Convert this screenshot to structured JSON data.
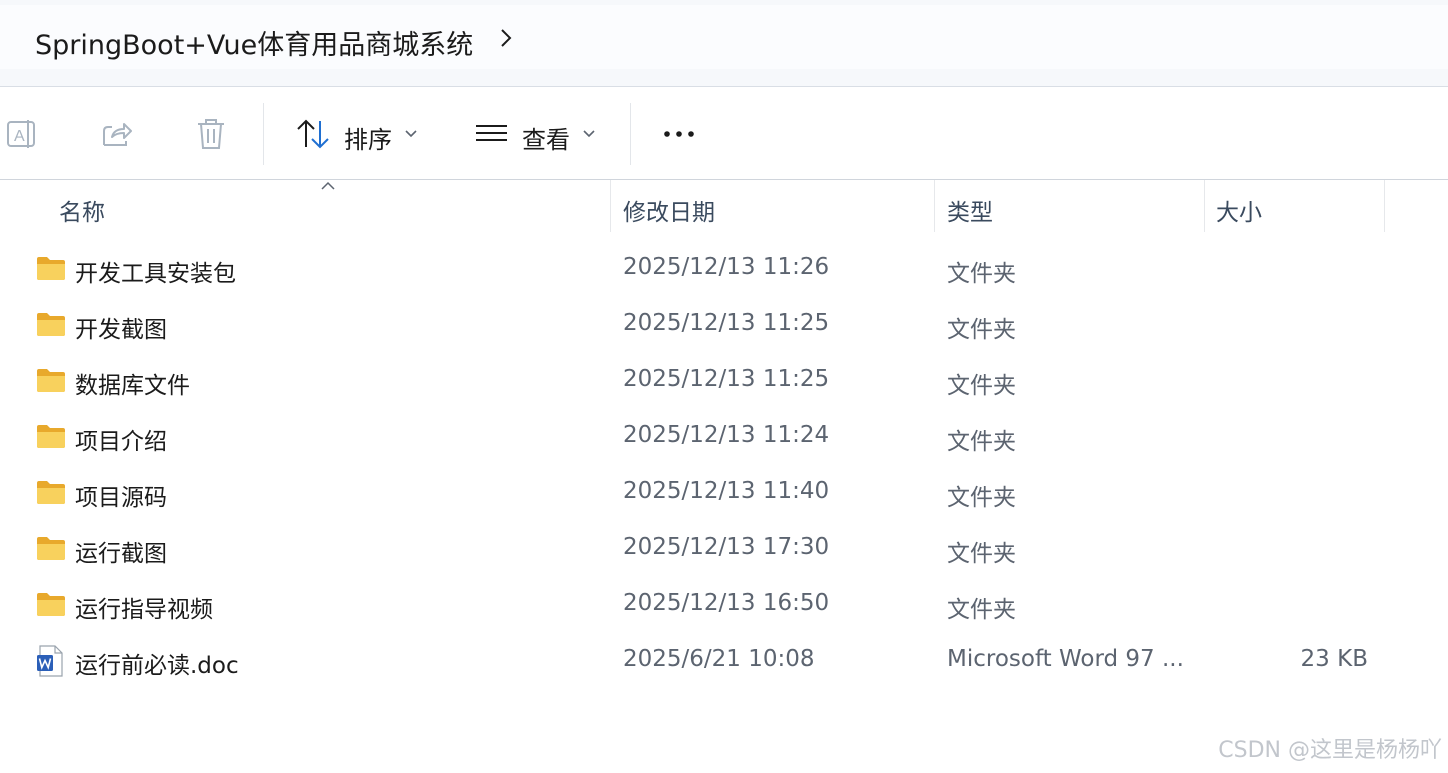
{
  "breadcrumb": {
    "path": "SpringBoot+Vue体育用品商城系统"
  },
  "toolbar": {
    "rename_icon": "rename-icon",
    "share_icon": "share-icon",
    "delete_icon": "trash-icon",
    "sort_label": "排序",
    "view_label": "查看",
    "more_label": "•••"
  },
  "columns": {
    "name": "名称",
    "date": "修改日期",
    "type": "类型",
    "size": "大小"
  },
  "files": [
    {
      "name": "开发工具安装包",
      "date": "2025/12/13 11:26",
      "type": "文件夹",
      "size": "",
      "icon": "folder-icon"
    },
    {
      "name": "开发截图",
      "date": "2025/12/13 11:25",
      "type": "文件夹",
      "size": "",
      "icon": "folder-icon"
    },
    {
      "name": "数据库文件",
      "date": "2025/12/13 11:25",
      "type": "文件夹",
      "size": "",
      "icon": "folder-icon"
    },
    {
      "name": "项目介绍",
      "date": "2025/12/13 11:24",
      "type": "文件夹",
      "size": "",
      "icon": "folder-icon"
    },
    {
      "name": "项目源码",
      "date": "2025/12/13 11:40",
      "type": "文件夹",
      "size": "",
      "icon": "folder-icon"
    },
    {
      "name": "运行截图",
      "date": "2025/12/13 17:30",
      "type": "文件夹",
      "size": "",
      "icon": "folder-icon"
    },
    {
      "name": "运行指导视频",
      "date": "2025/12/13 16:50",
      "type": "文件夹",
      "size": "",
      "icon": "folder-icon"
    },
    {
      "name": "运行前必读.doc",
      "date": "2025/6/21 10:08",
      "type": "Microsoft Word 97 ...",
      "size": "23 KB",
      "icon": "word-doc-icon"
    }
  ],
  "watermark": "CSDN @这里是杨杨吖",
  "colors": {
    "folder": "#f5c542",
    "accent": "#1f6fd1",
    "disabled_icon": "#a9b4c0"
  }
}
